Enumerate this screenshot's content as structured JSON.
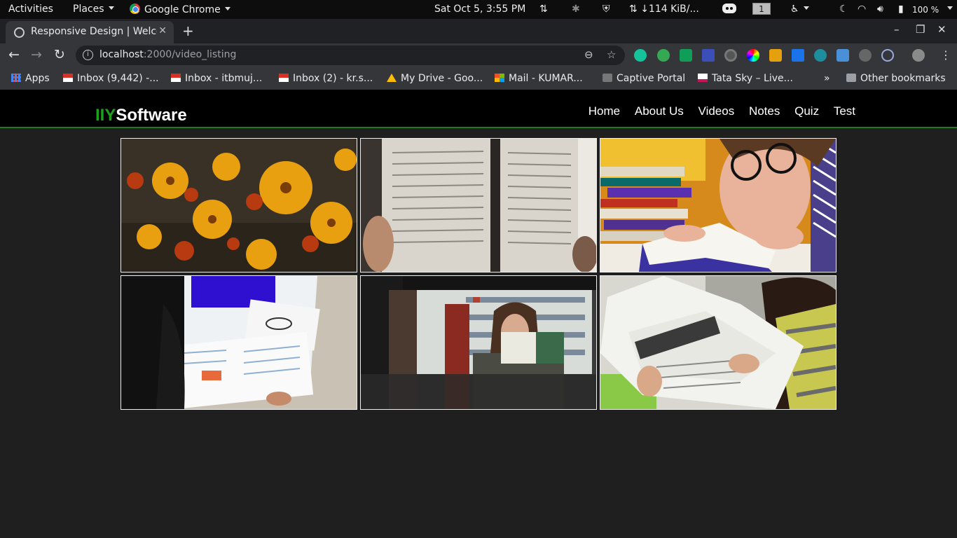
{
  "system": {
    "activities": "Activities",
    "places": "Places",
    "app": "Google Chrome",
    "clock": "Sat Oct  5,  3:55 PM",
    "network_speed": "↓114 KiB/...",
    "workspace": "1",
    "battery": "100 %"
  },
  "browser": {
    "tab_title": "Responsive Design | Welcome",
    "url_host": "localhost",
    "url_path": ":2000/video_listing",
    "bookmarks": [
      {
        "label": "Apps"
      },
      {
        "label": "Inbox (9,442) -..."
      },
      {
        "label": "Inbox - itbmuj..."
      },
      {
        "label": "Inbox (2) - kr.s..."
      },
      {
        "label": "My Drive - Goo..."
      },
      {
        "label": "Mail - KUMAR..."
      },
      {
        "label": "Captive Portal"
      },
      {
        "label": "Tata Sky – Live..."
      }
    ],
    "other_bookmarks": "Other bookmarks"
  },
  "site": {
    "logo_accent": "IIY",
    "logo_rest": "Software",
    "nav": [
      "Home",
      "About Us",
      "Videos",
      "Notes",
      "Quiz",
      "Test"
    ],
    "accent_color": "#1da11d"
  },
  "videos": [
    {
      "id": "flowers",
      "scene": "marigold-flowers"
    },
    {
      "id": "open-book",
      "scene": "open-book-pages"
    },
    {
      "id": "girl-reading",
      "scene": "girl-reading-glasses"
    },
    {
      "id": "student-desk",
      "scene": "student-workbook-desk"
    },
    {
      "id": "library",
      "scene": "library-shelves"
    },
    {
      "id": "newspaper",
      "scene": "woman-reading-newspaper"
    }
  ]
}
